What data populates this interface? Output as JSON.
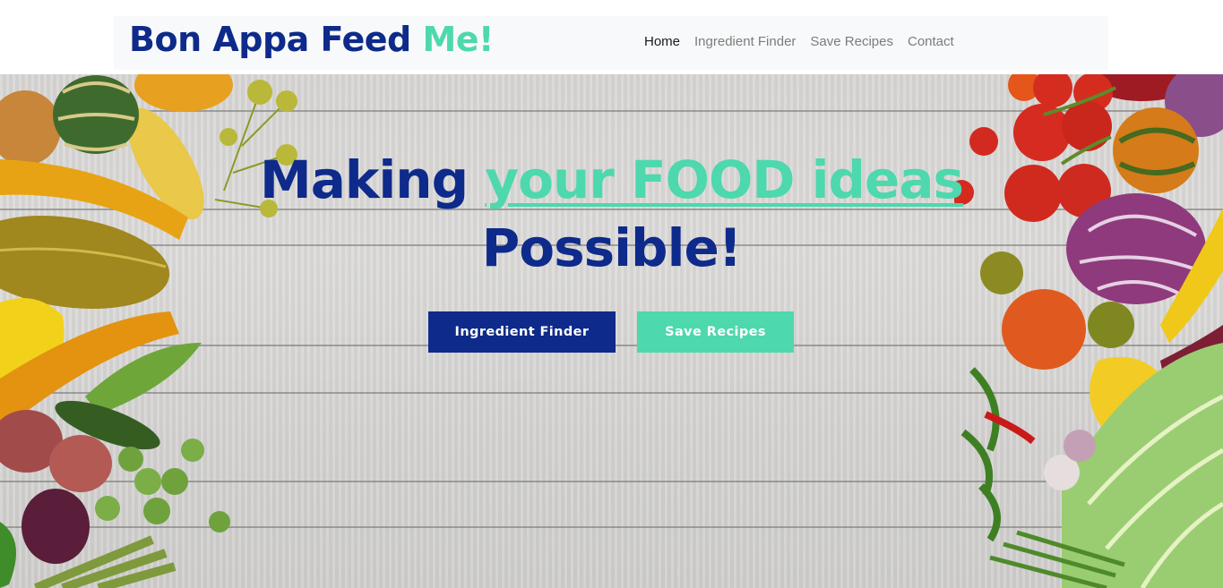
{
  "brand": {
    "main": "Bon Appa Feed ",
    "accent": "Me!"
  },
  "nav": {
    "items": [
      {
        "label": "Home",
        "active": true
      },
      {
        "label": "Ingredient Finder",
        "active": false
      },
      {
        "label": "Save Recipes",
        "active": false
      },
      {
        "label": "Contact",
        "active": false
      }
    ]
  },
  "hero": {
    "headline_part1": "Making ",
    "headline_accent": "your FOOD ideas",
    "headline_part2": "Possible!",
    "primary_button": "Ingredient Finder",
    "secondary_button": "Save Recipes"
  },
  "colors": {
    "brand_blue": "#0e2a8a",
    "brand_teal": "#4dd8ad",
    "navbar_bg": "#f8f9fa"
  }
}
